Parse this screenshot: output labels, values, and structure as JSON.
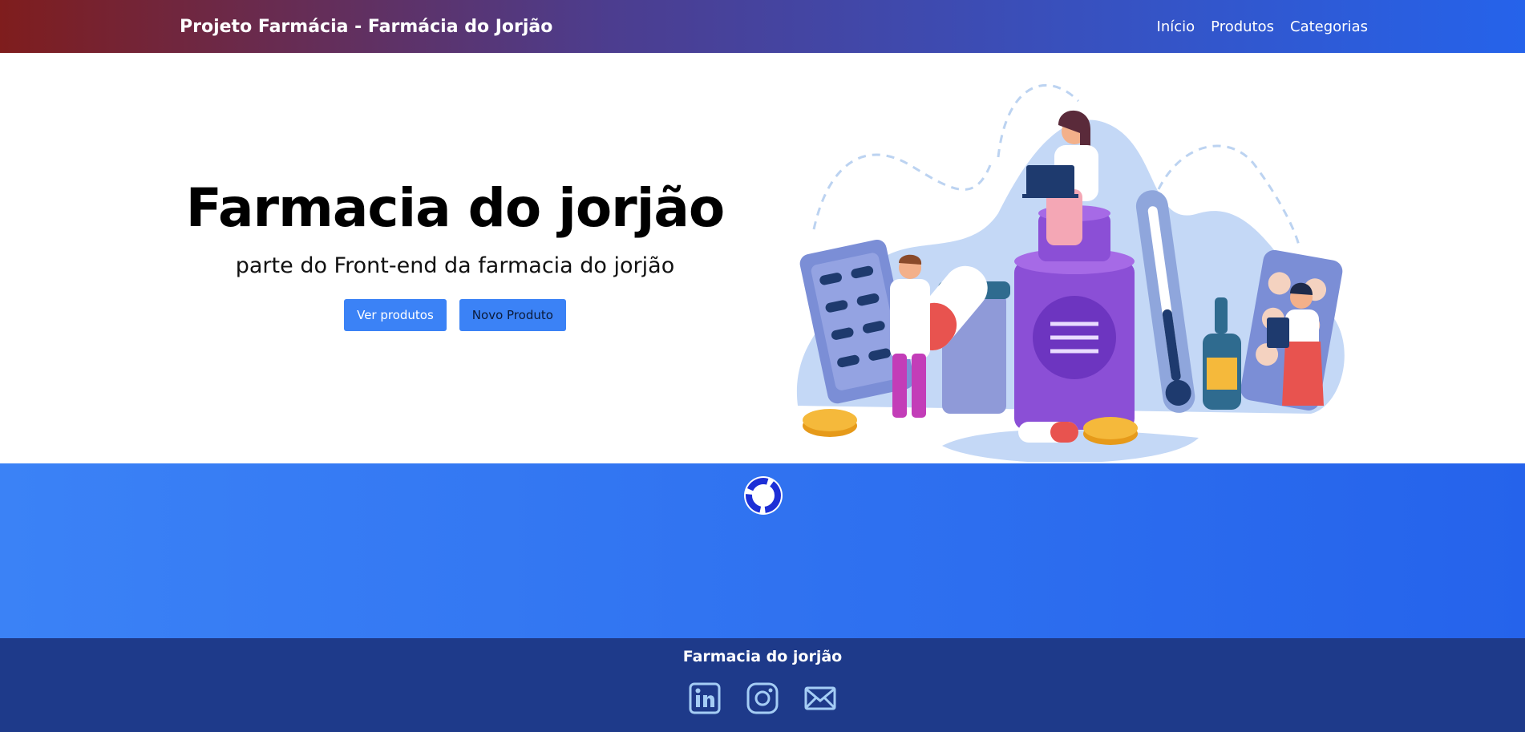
{
  "navbar": {
    "brand": "Projeto Farmácia - Farmácia do Jorjão",
    "links": [
      "Início",
      "Produtos",
      "Categorias"
    ]
  },
  "hero": {
    "title": "Farmacia do jorjão",
    "subtitle": "parte do Front-end da farmacia do jorjão",
    "buttons": [
      "Ver produtos",
      "Novo Produto"
    ]
  },
  "footer": {
    "title": "Farmacia do jorjão",
    "icons": [
      "linkedin-icon",
      "instagram-icon",
      "mail-icon"
    ]
  },
  "colors": {
    "nav_gradient_start": "#7f1d1d",
    "nav_gradient_end": "#2563eb",
    "primary": "#3b82f6",
    "footer": "#1e3a8a"
  }
}
